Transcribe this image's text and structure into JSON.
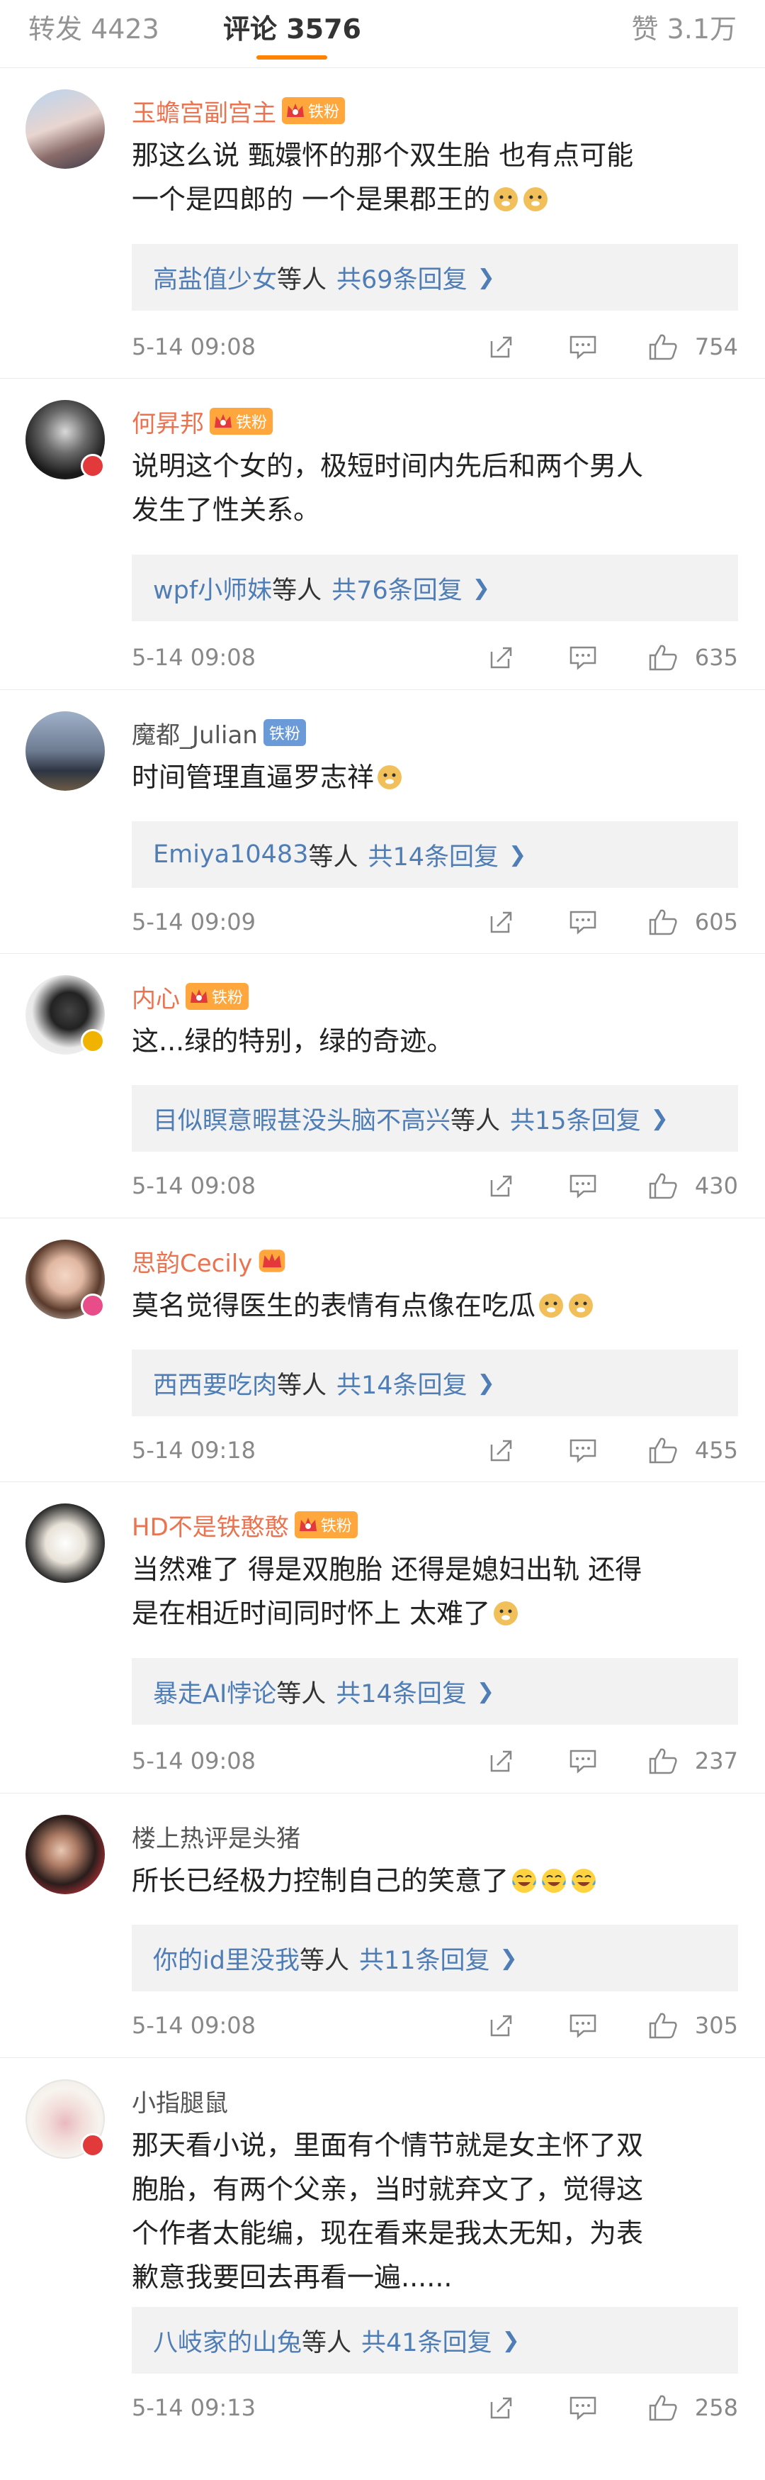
{
  "tabs": {
    "repost": "转发 4423",
    "comments": "评论 3576",
    "likes": "赞 3.1万"
  },
  "comments": [
    {
      "name": "玉蟾宫副宫主",
      "badge": "铁粉",
      "lines": [
        "那这么说 甄嬛怀的那个双生胎 也有点可能",
        "一个是四郎的 一个是果郡王的"
      ],
      "reply_users": "高盐值少女",
      "reply_suffix": "等人",
      "reply_count": "共69条回复",
      "time": "5-14 09:08",
      "likes": "754"
    },
    {
      "name": "何昇邦",
      "badge": "铁粉",
      "lines": [
        "说明这个女的，极短时间内先后和两个男人",
        "发生了性关系。"
      ],
      "reply_users": "wpf小师妹",
      "reply_suffix": "等人",
      "reply_count": "共76条回复",
      "time": "5-14 09:08",
      "likes": "635"
    },
    {
      "name": "魔都_Julian",
      "badge": "铁粉",
      "lines": [
        "时间管理直逼罗志祥"
      ],
      "reply_users": "Emiya10483",
      "reply_suffix": "等人",
      "reply_count": "共14条回复",
      "time": "5-14 09:09",
      "likes": "605"
    },
    {
      "name": "内心",
      "badge": "铁粉",
      "lines": [
        "这...绿的特别，绿的奇迹。"
      ],
      "reply_users": "目似瞑意暇甚没头脑不高兴",
      "reply_suffix": "等人",
      "reply_count": "共15条回复",
      "time": "5-14 09:08",
      "likes": "430"
    },
    {
      "name": "思韵Cecily",
      "badge": "",
      "lines": [
        "莫名觉得医生的表情有点像在吃瓜"
      ],
      "reply_users": "西西要吃肉",
      "reply_suffix": "等人",
      "reply_count": "共14条回复",
      "time": "5-14 09:18",
      "likes": "455"
    },
    {
      "name": "HD不是铁憨憨",
      "badge": "铁粉",
      "lines": [
        "当然难了 得是双胞胎 还得是媳妇出轨 还得",
        "是在相近时间同时怀上 太难了"
      ],
      "reply_users": "暴走AI悖论",
      "reply_suffix": "等人",
      "reply_count": "共14条回复",
      "time": "5-14 09:08",
      "likes": "237"
    },
    {
      "name": "楼上热评是头猪",
      "badge": "",
      "lines": [
        "所长已经极力控制自己的笑意了"
      ],
      "reply_users": "你的id里没我",
      "reply_suffix": "等人",
      "reply_count": "共11条回复",
      "time": "5-14 09:08",
      "likes": "305"
    },
    {
      "name": "小指腿鼠",
      "badge": "",
      "lines": [
        "那天看小说，里面有个情节就是女主怀了双",
        "胞胎，有两个父亲，当时就弃文了，觉得这",
        "个作者太能编，现在看来是我太无知，为表",
        "歉意我要回去再看一遍......"
      ],
      "reply_users": "八岐家的山兔",
      "reply_suffix": "等人",
      "reply_count": "共41条回复",
      "time": "5-14 09:13",
      "likes": "258"
    }
  ],
  "colors": {
    "accent": "#ff8200",
    "name_orange": "#eb7350",
    "link_blue": "#4f7db5",
    "fan_badge": "#ffa63d",
    "meta_grey": "#888888"
  }
}
